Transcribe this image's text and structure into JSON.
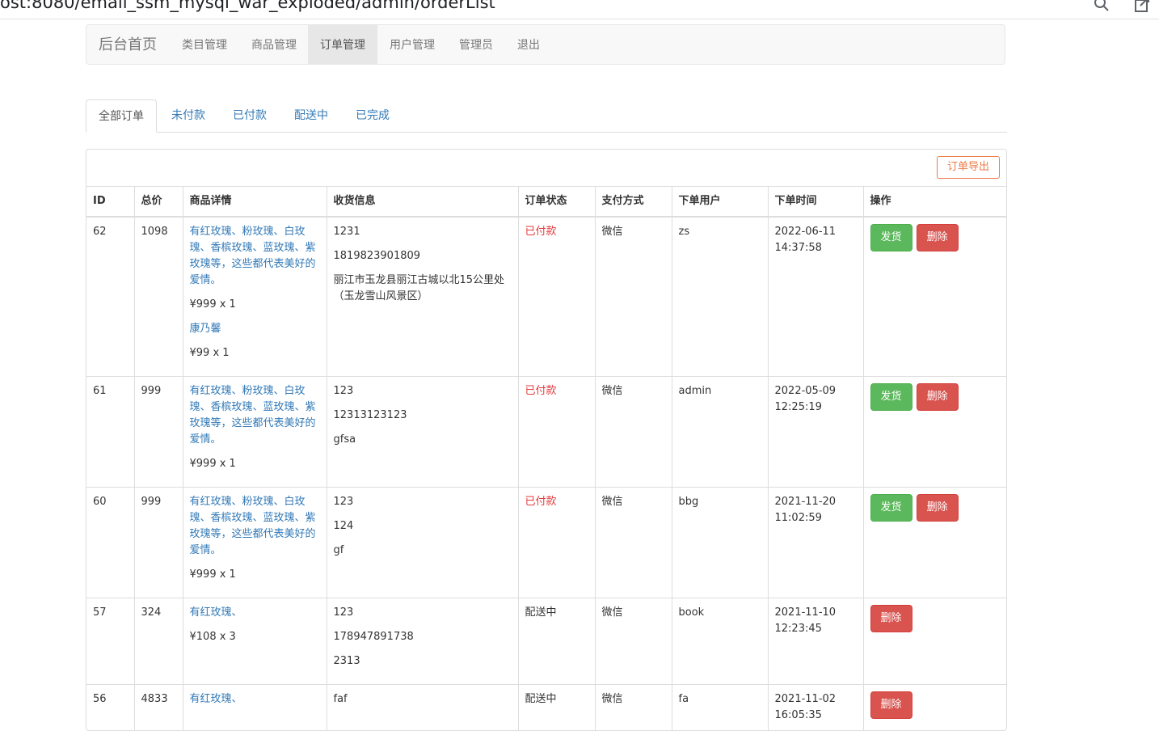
{
  "browser": {
    "url": "ost:8080/email_ssm_mysql_war_exploded/admin/orderList"
  },
  "navbar": {
    "brand": "后台首页",
    "items": [
      {
        "label": "类目管理"
      },
      {
        "label": "商品管理"
      },
      {
        "label": "订单管理",
        "active": true
      },
      {
        "label": "用户管理"
      },
      {
        "label": "管理员"
      },
      {
        "label": "退出"
      }
    ]
  },
  "tabs": [
    {
      "label": "全部订单",
      "active": true
    },
    {
      "label": "未付款"
    },
    {
      "label": "已付款"
    },
    {
      "label": "配送中"
    },
    {
      "label": "已完成"
    }
  ],
  "export_label": "订单导出",
  "table": {
    "headers": [
      "ID",
      "总价",
      "商品详情",
      "收货信息",
      "订单状态",
      "支付方式",
      "下单用户",
      "下单时间",
      "操作"
    ],
    "ship_label": "发货",
    "delete_label": "删除",
    "rows": [
      {
        "id": "62",
        "total": "1098",
        "items": [
          {
            "name": "有红玫瑰、粉玫瑰、白玫瑰、香槟玫瑰、蓝玫瑰、紫玫瑰等，这些都代表美好的爱情。",
            "qty": "¥999 x 1"
          },
          {
            "name": "康乃馨",
            "qty": "¥99 x 1"
          }
        ],
        "receiver": "1231",
        "phone": "1819823901809",
        "address": "丽江市玉龙县丽江古城以北15公里处（玉龙雪山风景区）",
        "status": "已付款",
        "status_color": "#e4393c",
        "pay": "微信",
        "user": "zs",
        "date": "2022-06-11",
        "time": "14:37:58",
        "can_ship": true
      },
      {
        "id": "61",
        "total": "999",
        "items": [
          {
            "name": "有红玫瑰、粉玫瑰、白玫瑰、香槟玫瑰、蓝玫瑰、紫玫瑰等，这些都代表美好的爱情。",
            "qty": "¥999 x 1"
          }
        ],
        "receiver": "123",
        "phone": "12313123123",
        "address": "gfsa",
        "status": "已付款",
        "status_color": "#e4393c",
        "pay": "微信",
        "user": "admin",
        "date": "2022-05-09",
        "time": "12:25:19",
        "can_ship": true
      },
      {
        "id": "60",
        "total": "999",
        "items": [
          {
            "name": "有红玫瑰、粉玫瑰、白玫瑰、香槟玫瑰、蓝玫瑰、紫玫瑰等，这些都代表美好的爱情。",
            "qty": "¥999 x 1"
          }
        ],
        "receiver": "123",
        "phone": "124",
        "address": "gf",
        "status": "已付款",
        "status_color": "#e4393c",
        "pay": "微信",
        "user": "bbg",
        "date": "2021-11-20",
        "time": "11:02:59",
        "can_ship": true
      },
      {
        "id": "57",
        "total": "324",
        "items": [
          {
            "name": "有红玫瑰、",
            "qty": "¥108 x 3"
          }
        ],
        "receiver": "123",
        "phone": "178947891738",
        "address": "2313",
        "status": "配送中",
        "status_color": "#333333",
        "pay": "微信",
        "user": "book",
        "date": "2021-11-10",
        "time": "12:23:45",
        "can_ship": false
      },
      {
        "id": "56",
        "total": "4833",
        "items": [
          {
            "name": "有红玫瑰、",
            "qty": ""
          }
        ],
        "receiver": "faf",
        "phone": "",
        "address": "",
        "status": "配送中",
        "status_color": "#333333",
        "pay": "微信",
        "user": "fa",
        "date": "2021-11-02",
        "time": "16:05:35",
        "can_ship": false
      }
    ]
  }
}
